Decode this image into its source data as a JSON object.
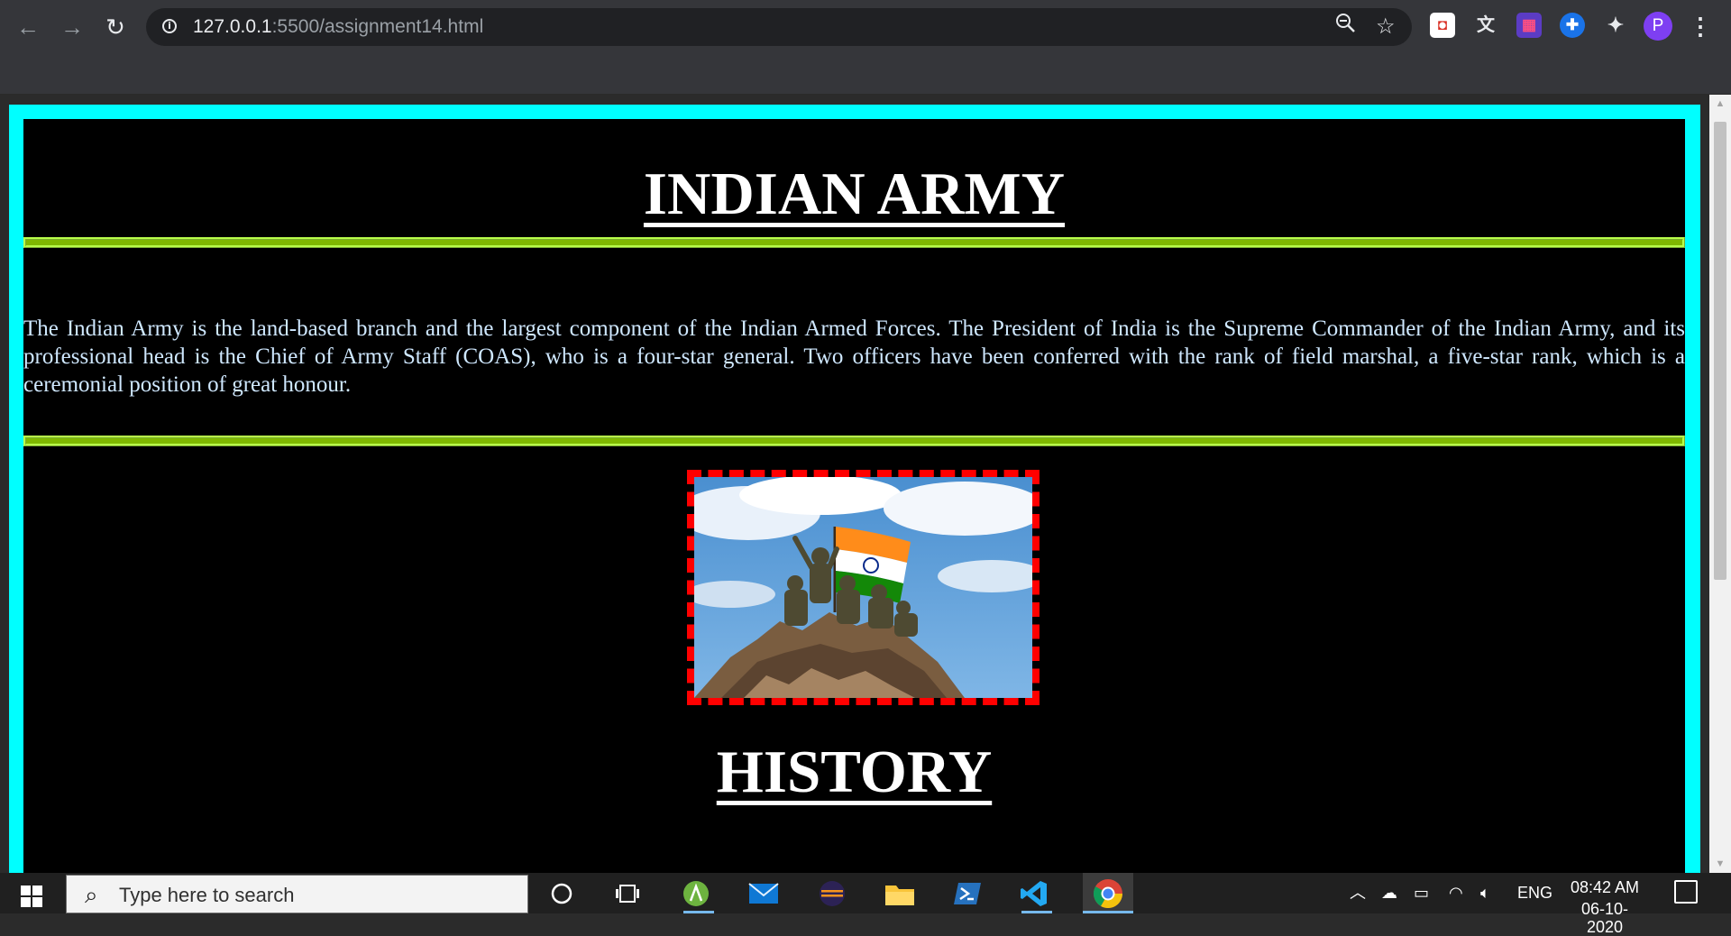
{
  "browser": {
    "url_host": "127.0.0.1",
    "url_rest": ":5500/assignment14.html",
    "profile_initial": "P",
    "extensions": [
      "shield-icon",
      "translate-icon",
      "grid-icon",
      "gamepad-icon",
      "puzzle-icon"
    ],
    "accent": "#7e3ff2"
  },
  "page": {
    "title": "INDIAN ARMY",
    "intro": "The Indian Army is the land-based branch and the largest component of the Indian Armed Forces. The President of India is the Supreme Commander of the Indian Army, and its professional head is the Chief of Army Staff (COAS), who is a four-star general. Two officers have been conferred with the rank of field marshal, a five-star rank, which is a ceremonial position of great honour.",
    "history_title": "HISTORY",
    "colors": {
      "frame": "#00ffff",
      "background": "#000000",
      "rule": "#7fb800",
      "image_border": "#ff0000",
      "intro_text": "#cfe8ff"
    }
  },
  "taskbar": {
    "search_placeholder": "Type here to search",
    "language": "ENG",
    "time": "08:42 AM",
    "date": "06-10-2020"
  }
}
